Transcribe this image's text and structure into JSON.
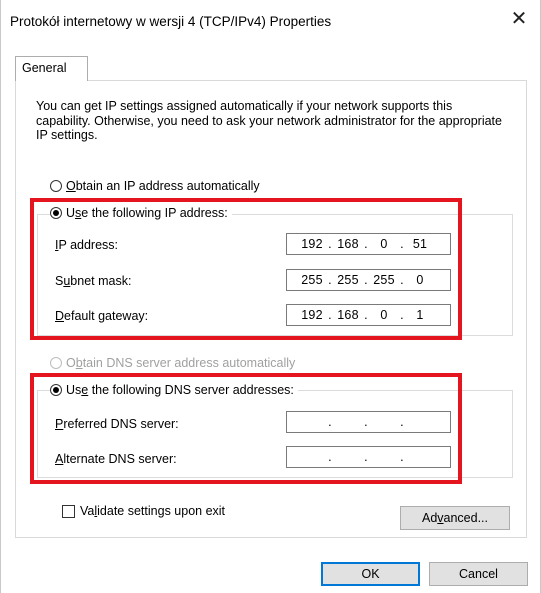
{
  "window": {
    "title": "Protokół internetowy w wersji 4 (TCP/IPv4) Properties",
    "close_glyph": "✕"
  },
  "tabs": [
    {
      "label": "General",
      "selected": true
    }
  ],
  "description": "You can get IP settings assigned automatically if your network supports this capability. Otherwise, you need to ask your network administrator for the appropriate IP settings.",
  "ip_section": {
    "auto_option": {
      "pre": "",
      "key": "O",
      "post": "btain an IP address automatically",
      "checked": false
    },
    "manual_option": {
      "pre": "U",
      "key": "s",
      "post": "e the following IP address:",
      "checked": true
    },
    "fields": [
      {
        "pre": "",
        "key": "I",
        "post": "P address:",
        "segments": [
          "192",
          "168",
          "0",
          "51"
        ]
      },
      {
        "pre": "S",
        "key": "u",
        "post": "bnet mask:",
        "segments": [
          "255",
          "255",
          "255",
          "0"
        ]
      },
      {
        "pre": "",
        "key": "D",
        "post": "efault gateway:",
        "segments": [
          "192",
          "168",
          "0",
          "1"
        ]
      }
    ]
  },
  "dns_section": {
    "auto_option": {
      "pre": "O",
      "key": "b",
      "post": "tain DNS server address automatically",
      "checked": false,
      "disabled": true
    },
    "manual_option": {
      "pre": "Us",
      "key": "e",
      "post": " the following DNS server addresses:",
      "checked": true
    },
    "fields": [
      {
        "pre": "",
        "key": "P",
        "post": "referred DNS server:",
        "segments": [
          "",
          "",
          "",
          ""
        ]
      },
      {
        "pre": "",
        "key": "A",
        "post": "lternate DNS server:",
        "segments": [
          "",
          "",
          "",
          ""
        ]
      }
    ]
  },
  "validate": {
    "pre": "Va",
    "key": "l",
    "post": "idate settings upon exit",
    "checked": false
  },
  "buttons": {
    "advanced": {
      "pre": "Ad",
      "key": "v",
      "post": "anced..."
    },
    "ok": "OK",
    "cancel": "Cancel"
  },
  "colors": {
    "highlight": "#e5151f",
    "default_button_border": "#0078d7"
  }
}
